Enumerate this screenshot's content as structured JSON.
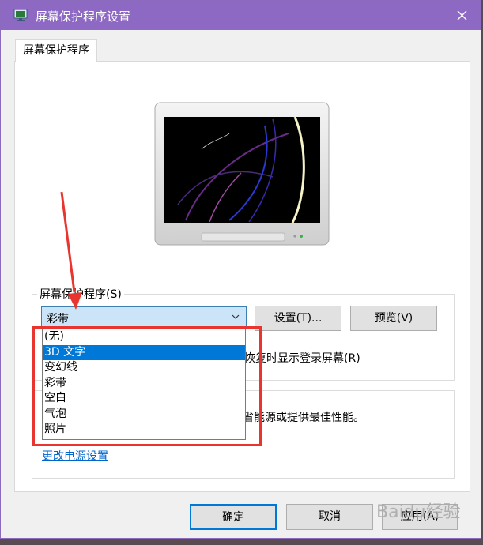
{
  "window": {
    "title": "屏幕保护程序设置",
    "icon": "monitor-app-icon",
    "close_icon": "close-icon"
  },
  "tabs": [
    {
      "label": "屏幕保护程序"
    }
  ],
  "screensaver_group": {
    "legend": "屏幕保护程序(S)",
    "selected": "彩带",
    "settings_label": "设置(T)...",
    "preview_label": "预览(V)",
    "resume_text": "恢复时显示登录屏幕(R)"
  },
  "dropdown": {
    "options": [
      "(无)",
      "3D 文字",
      "变幻线",
      "彩带",
      "空白",
      "气泡",
      "照片"
    ],
    "highlighted_index": 1
  },
  "power_group": {
    "partial_text": "省能源或提供最佳性能。",
    "link": "更改电源设置"
  },
  "footer": {
    "ok": "确定",
    "cancel": "取消",
    "apply": "应用(A)"
  },
  "watermark": "Baidu经验",
  "colors": {
    "titlebar": "#8e69c4",
    "select_bg": "#cce4f7",
    "highlight": "#0078d7",
    "annotation": "#e8352f",
    "link": "#0066cc"
  }
}
